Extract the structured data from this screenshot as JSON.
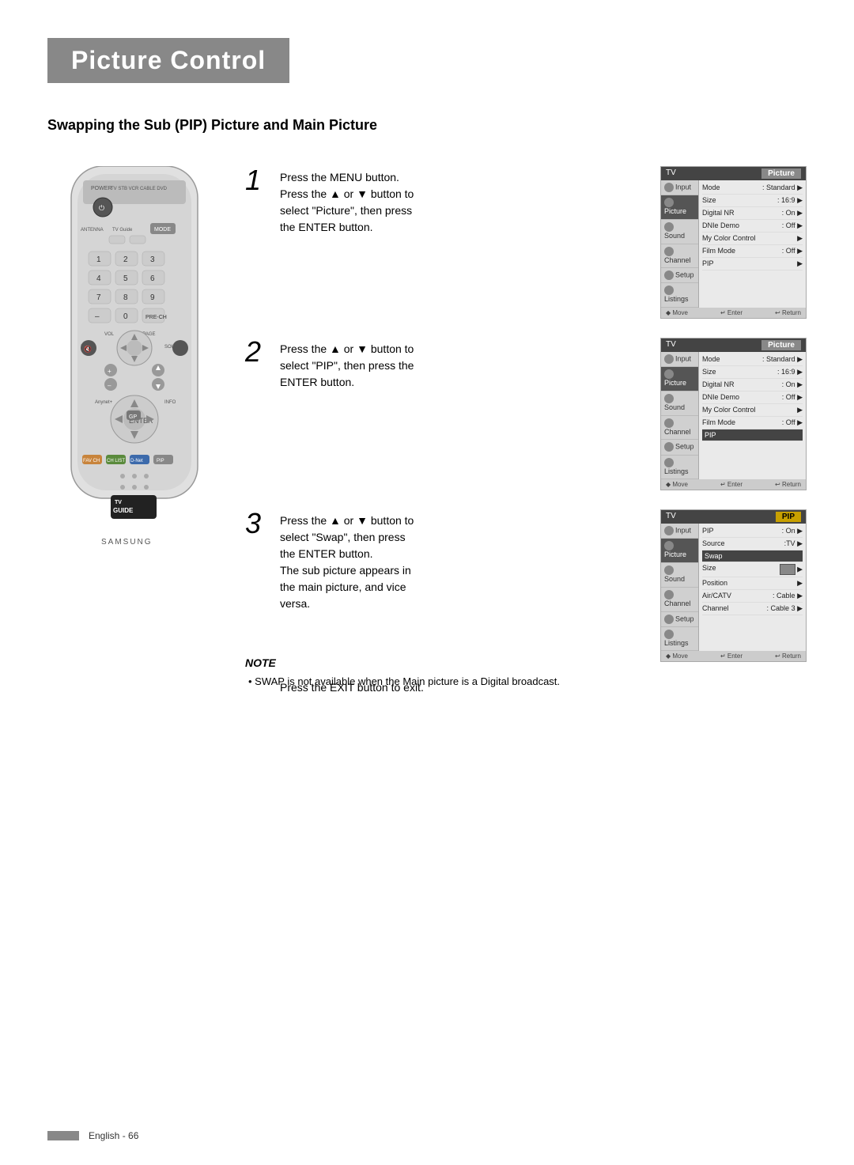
{
  "page": {
    "title": "Picture Control",
    "subtitle": "Swapping the Sub (PIP) Picture and Main Picture",
    "footer": "English - 66"
  },
  "steps": [
    {
      "number": "1",
      "text": "Press the MENU button.\nPress the ▲ or ▼ button to\nselect \"Picture\", then press\nthe ENTER button.",
      "screen_title": "Picture",
      "screen_type": "picture"
    },
    {
      "number": "2",
      "text": "Press the ▲ or ▼ button to\nselect \"PIP\", then press the\nENTER button.",
      "screen_title": "Picture",
      "screen_type": "picture2"
    },
    {
      "number": "3",
      "text": "Press the ▲ or ▼ button to\nselect \"Swap\", then press\nthe ENTER button.\nThe sub picture appears in\nthe main picture, and vice\nversa.",
      "screen_title": "PIP",
      "screen_type": "pip"
    }
  ],
  "exit_text": "Press the EXIT button to exit.",
  "note": {
    "title": "NOTE",
    "text": "SWAP is not available when the Main picture is a Digital broadcast."
  },
  "screens": {
    "picture": {
      "sidebar": [
        "Input",
        "Picture",
        "Sound",
        "Channel",
        "Setup",
        "Listings"
      ],
      "rows": [
        {
          "label": "Mode",
          "value": ": Standard",
          "arrow": true
        },
        {
          "label": "Size",
          "value": ": 16:9",
          "arrow": true
        },
        {
          "label": "Digital NR",
          "value": ": On",
          "arrow": true
        },
        {
          "label": "DNIe Demo",
          "value": ": Off",
          "arrow": true
        },
        {
          "label": "My Color Control",
          "value": "",
          "arrow": true
        },
        {
          "label": "Film Mode",
          "value": ": Off",
          "arrow": true
        },
        {
          "label": "PIP",
          "value": "",
          "arrow": true
        }
      ]
    },
    "pip": {
      "sidebar": [
        "Input",
        "Picture",
        "Sound",
        "Channel",
        "Setup",
        "Listings"
      ],
      "rows": [
        {
          "label": "PIP",
          "value": ": On",
          "arrow": true
        },
        {
          "label": "Source",
          "value": ":TV",
          "arrow": true
        },
        {
          "label": "Swap",
          "value": "",
          "arrow": false,
          "highlighted": true
        },
        {
          "label": "Size",
          "value": "",
          "arrow": true,
          "has_box": true
        },
        {
          "label": "Position",
          "value": "",
          "arrow": true
        },
        {
          "label": "Air/CATV",
          "value": ": Cable",
          "arrow": true
        },
        {
          "label": "Channel",
          "value": ": Cable 3",
          "arrow": true
        }
      ]
    }
  }
}
